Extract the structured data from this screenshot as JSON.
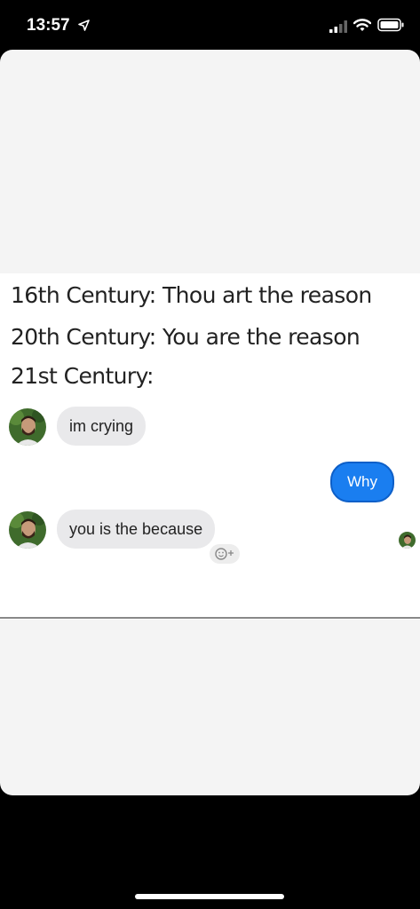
{
  "status_bar": {
    "time": "13:57",
    "icons": [
      "location-arrow-icon",
      "signal-icon",
      "wifi-icon",
      "battery-icon"
    ]
  },
  "meme": {
    "line1": "16th Century: Thou art the reason",
    "line2": "20th Century: You are the reason",
    "line3": "21st Century:"
  },
  "chat": {
    "messages": [
      {
        "side": "incoming",
        "text": "im crying"
      },
      {
        "side": "outgoing",
        "text": "Why"
      },
      {
        "side": "incoming",
        "text": "you is the because"
      }
    ]
  },
  "colors": {
    "outgoing_bubble": "#1a7ef0",
    "incoming_bubble": "#e9e9eb",
    "card_background": "#f4f4f4"
  }
}
